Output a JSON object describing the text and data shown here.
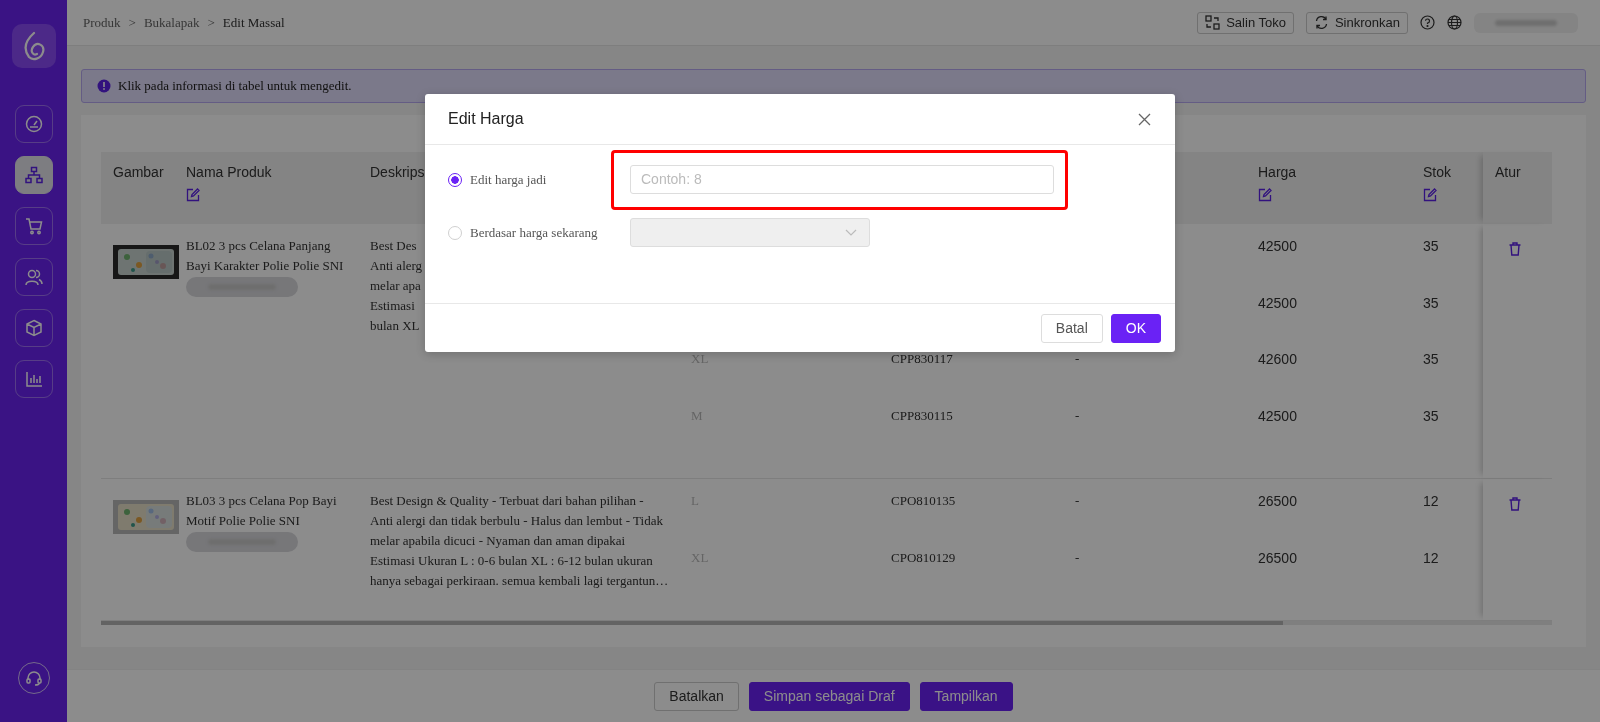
{
  "sidebar": {
    "items": [
      {
        "kind": "gauge",
        "selected": false
      },
      {
        "kind": "hierarchy",
        "selected": true
      },
      {
        "kind": "cart",
        "selected": false
      },
      {
        "kind": "users",
        "selected": false
      },
      {
        "kind": "box",
        "selected": false
      },
      {
        "kind": "chart",
        "selected": false
      }
    ]
  },
  "breadcrumb": {
    "separator": ">",
    "items": [
      "Produk",
      "Bukalapak",
      "Edit Massal"
    ]
  },
  "header_actions": [
    {
      "kind": "copy",
      "label": "Salin Toko"
    },
    {
      "kind": "sync",
      "label": "Sinkronkan"
    }
  ],
  "info_banner": "Klik pada informasi di tabel untuk mengedit.",
  "table": {
    "columns": [
      {
        "label": "Gambar",
        "editable": false
      },
      {
        "label": "Nama Produk",
        "editable": true
      },
      {
        "label": "Deskrips",
        "editable": false
      },
      {
        "label": "Harga",
        "editable": true
      },
      {
        "label": "Stok",
        "editable": true
      },
      {
        "label": "Atur",
        "editable": false
      }
    ],
    "rows": [
      {
        "name": "BL02 3 pcs Celana Panjang Bayi Karakter Polie Polie SNI",
        "description": [
          "Best Des",
          "Anti alerg",
          "melar apa",
          "Estimasi",
          "bulan XL"
        ],
        "variants": [
          {
            "price": "42500",
            "stock": "35"
          },
          {
            "price": "42500",
            "stock": "35"
          },
          {
            "column_4": "XL",
            "column_5": "CPP830117",
            "column_6": "-",
            "price": "42600",
            "stock": "35"
          },
          {
            "column_4": "M",
            "column_5": "CPP830115",
            "column_6": "-",
            "price": "42500",
            "stock": "35"
          }
        ]
      },
      {
        "name": "BL03 3 pcs Celana Pop Bayi Motif Polie Polie SNI",
        "description": [
          "Best Design & Quality - Terbuat dari bahan pilihan -",
          "Anti alergi dan tidak berbulu - Halus dan lembut - Tidak",
          "melar apabila dicuci - Nyaman dan aman dipakai",
          "Estimasi Ukuran L : 0-6 bulan XL : 6-12 bulan ukuran",
          "hanya sebagai perkiraan. semua kembali lagi tergantun…"
        ],
        "variants": [
          {
            "column_4": "L",
            "column_5": "CPO810135",
            "column_6": "-",
            "price": "26500",
            "stock": "12"
          },
          {
            "column_4": "XL",
            "column_5": "CPO810129",
            "column_6": "-",
            "price": "26500",
            "stock": "12"
          }
        ]
      }
    ]
  },
  "footer_buttons": [
    {
      "label": "Batalkan",
      "kind": "secondary"
    },
    {
      "label": "Simpan sebagai Draf",
      "kind": "primary"
    },
    {
      "label": "Tampilkan",
      "kind": "primary"
    }
  ],
  "modal": {
    "title": "Edit Harga",
    "options": [
      {
        "label": "Edit harga jadi",
        "selected": true,
        "kind": "input",
        "placeholder": "Contoh: 8",
        "highlighted": true
      },
      {
        "label": "Berdasar harga sekarang",
        "selected": false,
        "kind": "select",
        "disabled": true
      }
    ],
    "buttons": [
      {
        "label": "Batal",
        "kind": "secondary"
      },
      {
        "label": "OK",
        "kind": "primary"
      }
    ]
  }
}
